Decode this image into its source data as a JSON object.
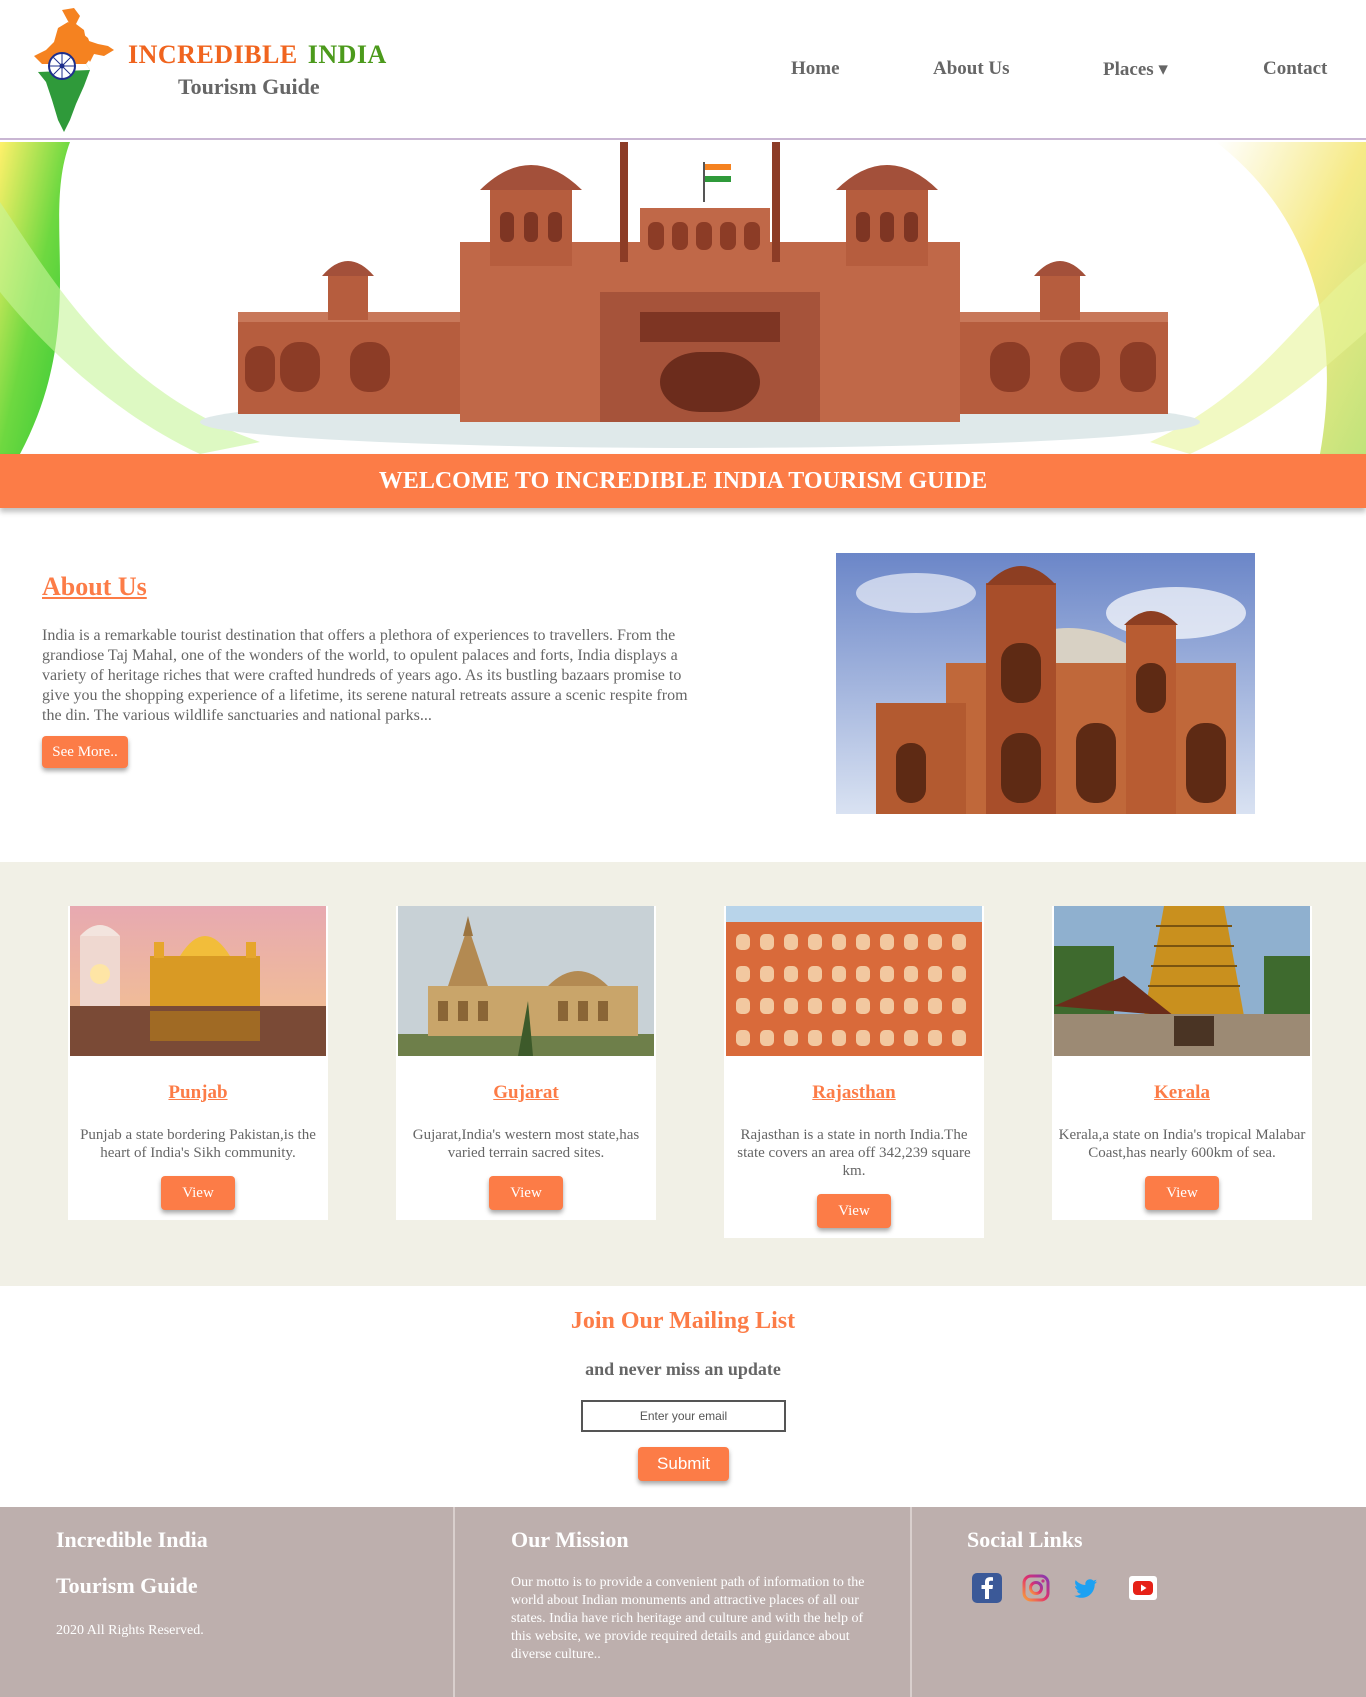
{
  "header": {
    "brand_word1": "INCREDIBLE",
    "brand_word2": "INDIA",
    "brand_sub": "Tourism Guide",
    "nav": [
      {
        "label": "Home"
      },
      {
        "label": "About Us"
      },
      {
        "label": "Places ▾"
      },
      {
        "label": "Contact"
      }
    ]
  },
  "welcome": {
    "text": "WELCOME TO INCREDIBLE INDIA TOURISM GUIDE"
  },
  "about": {
    "title": "About Us",
    "text": "India is a remarkable tourist destination that offers a plethora of experiences to travellers. From the grandiose Taj Mahal, one of the wonders of the world, to opulent palaces and forts, India displays a variety of heritage riches that were crafted hundreds of years ago. As its bustling bazaars promise to give you the shopping experience of a lifetime, its serene natural retreats assure a scenic respite from the din. The various wildlife sanctuaries and national parks...",
    "button": "See More.."
  },
  "places": [
    {
      "name": "Punjab",
      "text": "Punjab a state bordering Pakistan,is the heart of India's Sikh community.",
      "button": "View"
    },
    {
      "name": "Gujarat",
      "text": "Gujarat,India's western most state,has varied terrain sacred sites.",
      "button": "View"
    },
    {
      "name": "Rajasthan",
      "text": "Rajasthan is a state in north India.The state covers an area off 342,239 square km.",
      "button": "View"
    },
    {
      "name": "Kerala",
      "text": "Kerala,a state on India's tropical Malabar Coast,has nearly 600km of sea.",
      "button": "View"
    }
  ],
  "mailing": {
    "title": "Join Our Mailing List",
    "subtitle": "and never miss an update",
    "placeholder": "Enter your email",
    "submit": "Submit"
  },
  "footer": {
    "col1_title1": "Incredible India",
    "col1_title2": "Tourism Guide",
    "col1_text": "2020 All Rights Reserved.",
    "col2_title": "Our Mission",
    "col2_text": "Our motto is to provide a convenient path of information to the world about Indian monuments and attractive places of all our states. India have rich heritage and culture and with the help of this website, we provide required details and guidance about diverse culture..",
    "col3_title": "Social Links",
    "social_icons": [
      "facebook-icon",
      "instagram-icon",
      "twitter-icon",
      "youtube-icon"
    ]
  },
  "colors": {
    "accent": "#fc7c47",
    "brand_orange": "#f0641e",
    "brand_green": "#4c9a1c",
    "places_bg": "#f1f0e6",
    "footer_bg": "#bdafad"
  }
}
